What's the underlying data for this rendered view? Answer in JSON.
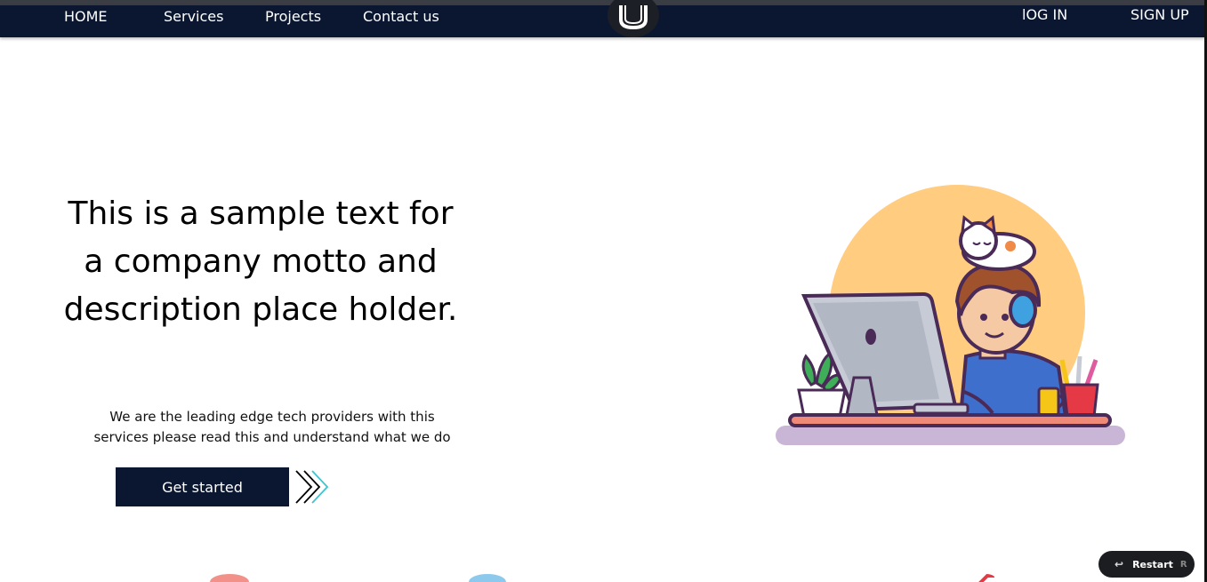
{
  "nav": {
    "home": "HOME",
    "services": "Services",
    "projects": "Projects",
    "contact": "Contact us",
    "login": "lOG IN",
    "signup": "SIGN UP"
  },
  "logo": {
    "icon": "u-logo-icon"
  },
  "hero": {
    "headline": "This is a sample text for a company motto and description place holder.",
    "subtext": "We are the leading edge tech providers with this services please read this and understand what we do",
    "cta_label": "Get started",
    "cta_icon": "double-chevron-right-icon",
    "illustration": "person-with-cat-at-computer-illustration"
  },
  "restart": {
    "label": "Restart",
    "shortcut": "R",
    "icon": "undo-arrow-icon"
  },
  "colors": {
    "navbar": "#0b1730",
    "accent_teal": "#3cc6d0",
    "sun_circle": "#ffcc80",
    "desk_shadow": "#c9b6d6"
  }
}
